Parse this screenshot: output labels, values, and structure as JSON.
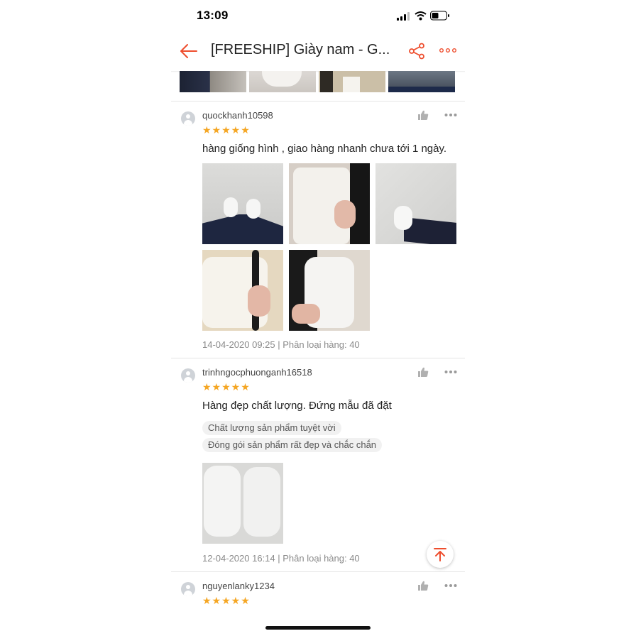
{
  "status_bar": {
    "time": "13:09"
  },
  "header": {
    "title": "[FREESHIP] Giày nam - G..."
  },
  "colors": {
    "accent": "#ee4d2d",
    "star": "#f5a623"
  },
  "reviews": [
    {
      "username": "quockhanh10598",
      "rating": 5,
      "stars": "★★★★★",
      "text": "hàng giống hình , giao hàng nhanh chưa tới 1 ngày.",
      "images": [
        "shoes-on-feet-photo",
        "shoe-side-photo",
        "shoe-worn-photo",
        "shoe-hand-photo",
        "shoe-held-photo"
      ],
      "meta": "14-04-2020 09:25 | Phân loại hàng: 40"
    },
    {
      "username": "trinhngocphuonganh16518",
      "rating": 5,
      "stars": "★★★★★",
      "text": "Hàng đẹp chất lượng. Đứng mẫu đã đặt",
      "tags": [
        "Chất lượng sản phẩm tuyệt vời",
        "Đóng gói sản phẩm rất đẹp và chắc chắn"
      ],
      "images": [
        "shoes-top-view-photo"
      ],
      "meta": "12-04-2020 16:14 | Phân loại hàng: 40"
    },
    {
      "username": "nguyenlanky1234",
      "rating": 5,
      "stars": "★★★★★"
    }
  ]
}
